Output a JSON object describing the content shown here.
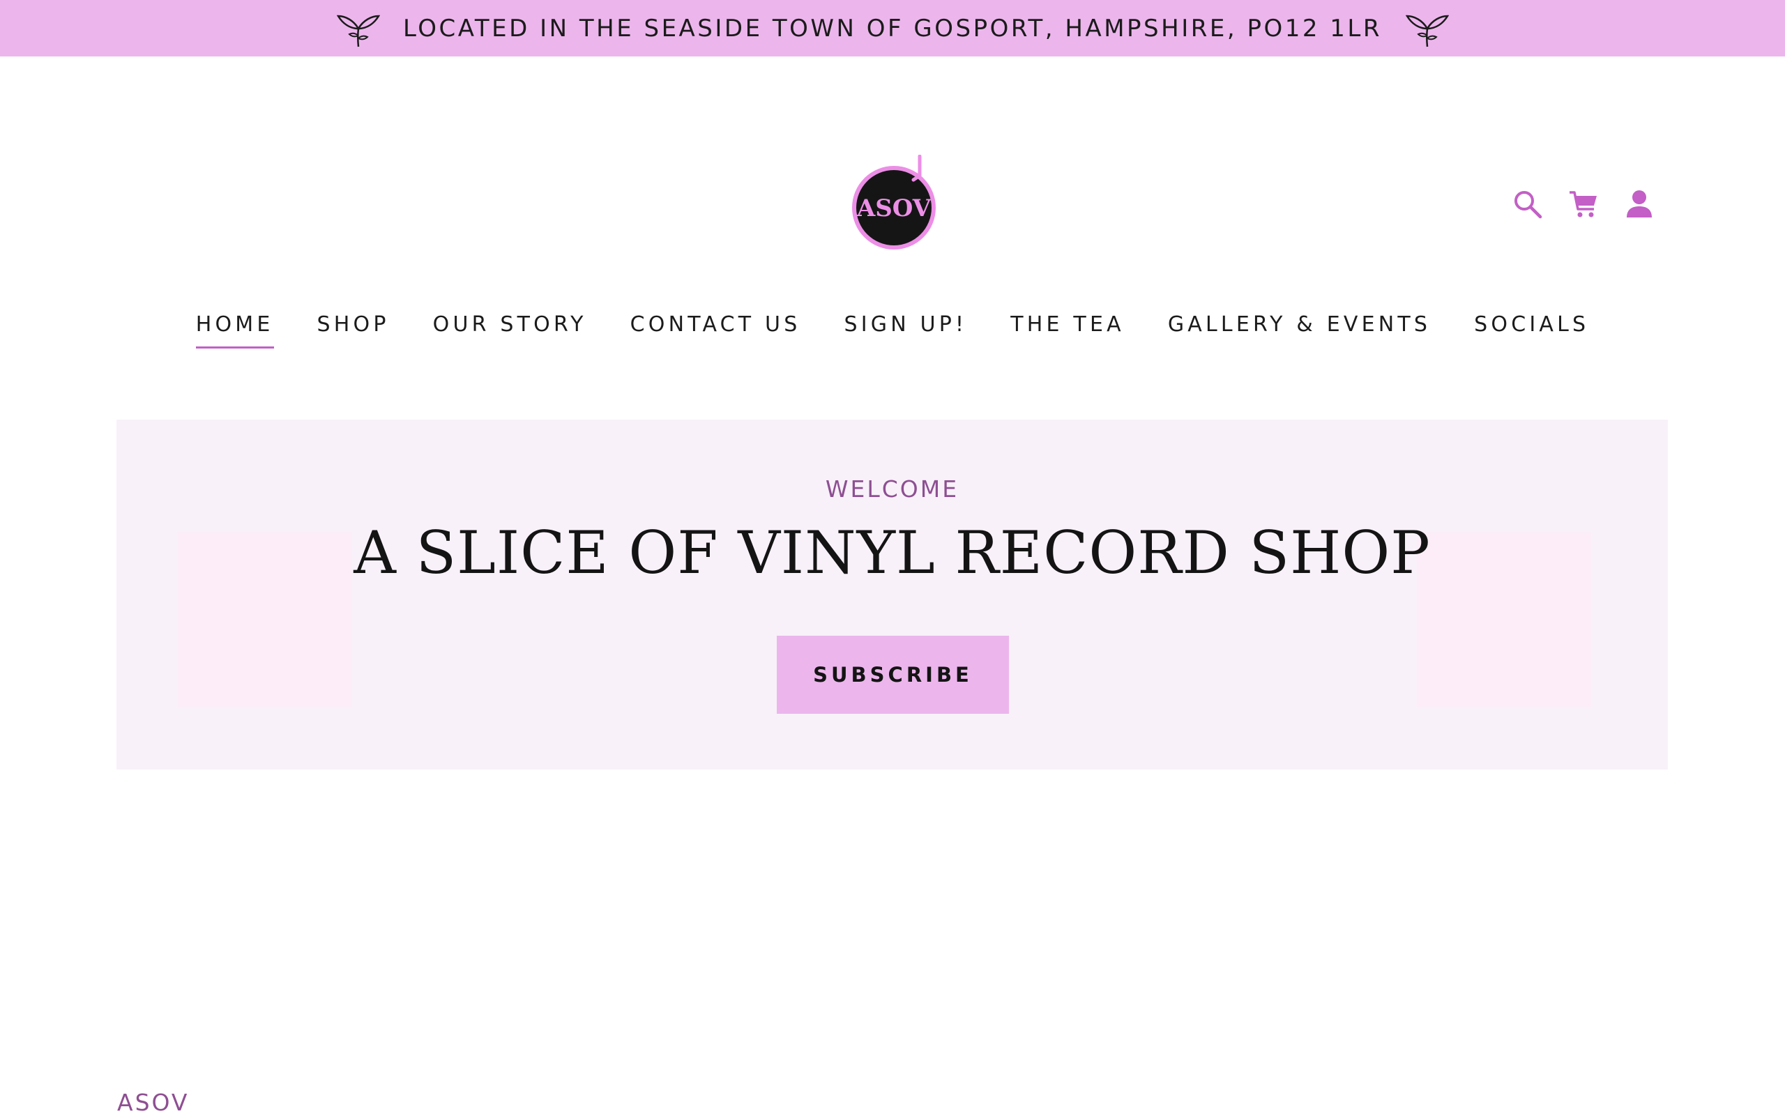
{
  "announcement": {
    "text": "LOCATED IN THE SEASIDE TOWN OF GOSPORT, HAMPSHIRE, PO12 1LR",
    "left_icon": "leaf-sprout-icon",
    "right_icon": "leaf-sprout-icon",
    "background": "#ecb6ec"
  },
  "header": {
    "logo_text": "ASOV",
    "icons": [
      "search-icon",
      "cart-icon",
      "account-icon"
    ],
    "icon_color": "#c35fc6"
  },
  "nav": {
    "items": [
      {
        "label": "HOME",
        "active": true
      },
      {
        "label": "SHOP"
      },
      {
        "label": "OUR STORY"
      },
      {
        "label": "CONTACT US"
      },
      {
        "label": "SIGN UP!"
      },
      {
        "label": "THE TEA"
      },
      {
        "label": "GALLERY & EVENTS"
      },
      {
        "label": "SOCIALS"
      }
    ]
  },
  "hero": {
    "eyebrow": "WELCOME",
    "title": "A SLICE OF VINYL RECORD SHOP",
    "button_label": "SUBSCRIBE",
    "background": "#f8f1f9",
    "accent": "#ecb6ec"
  },
  "footer": {
    "brand": "ASOV"
  }
}
